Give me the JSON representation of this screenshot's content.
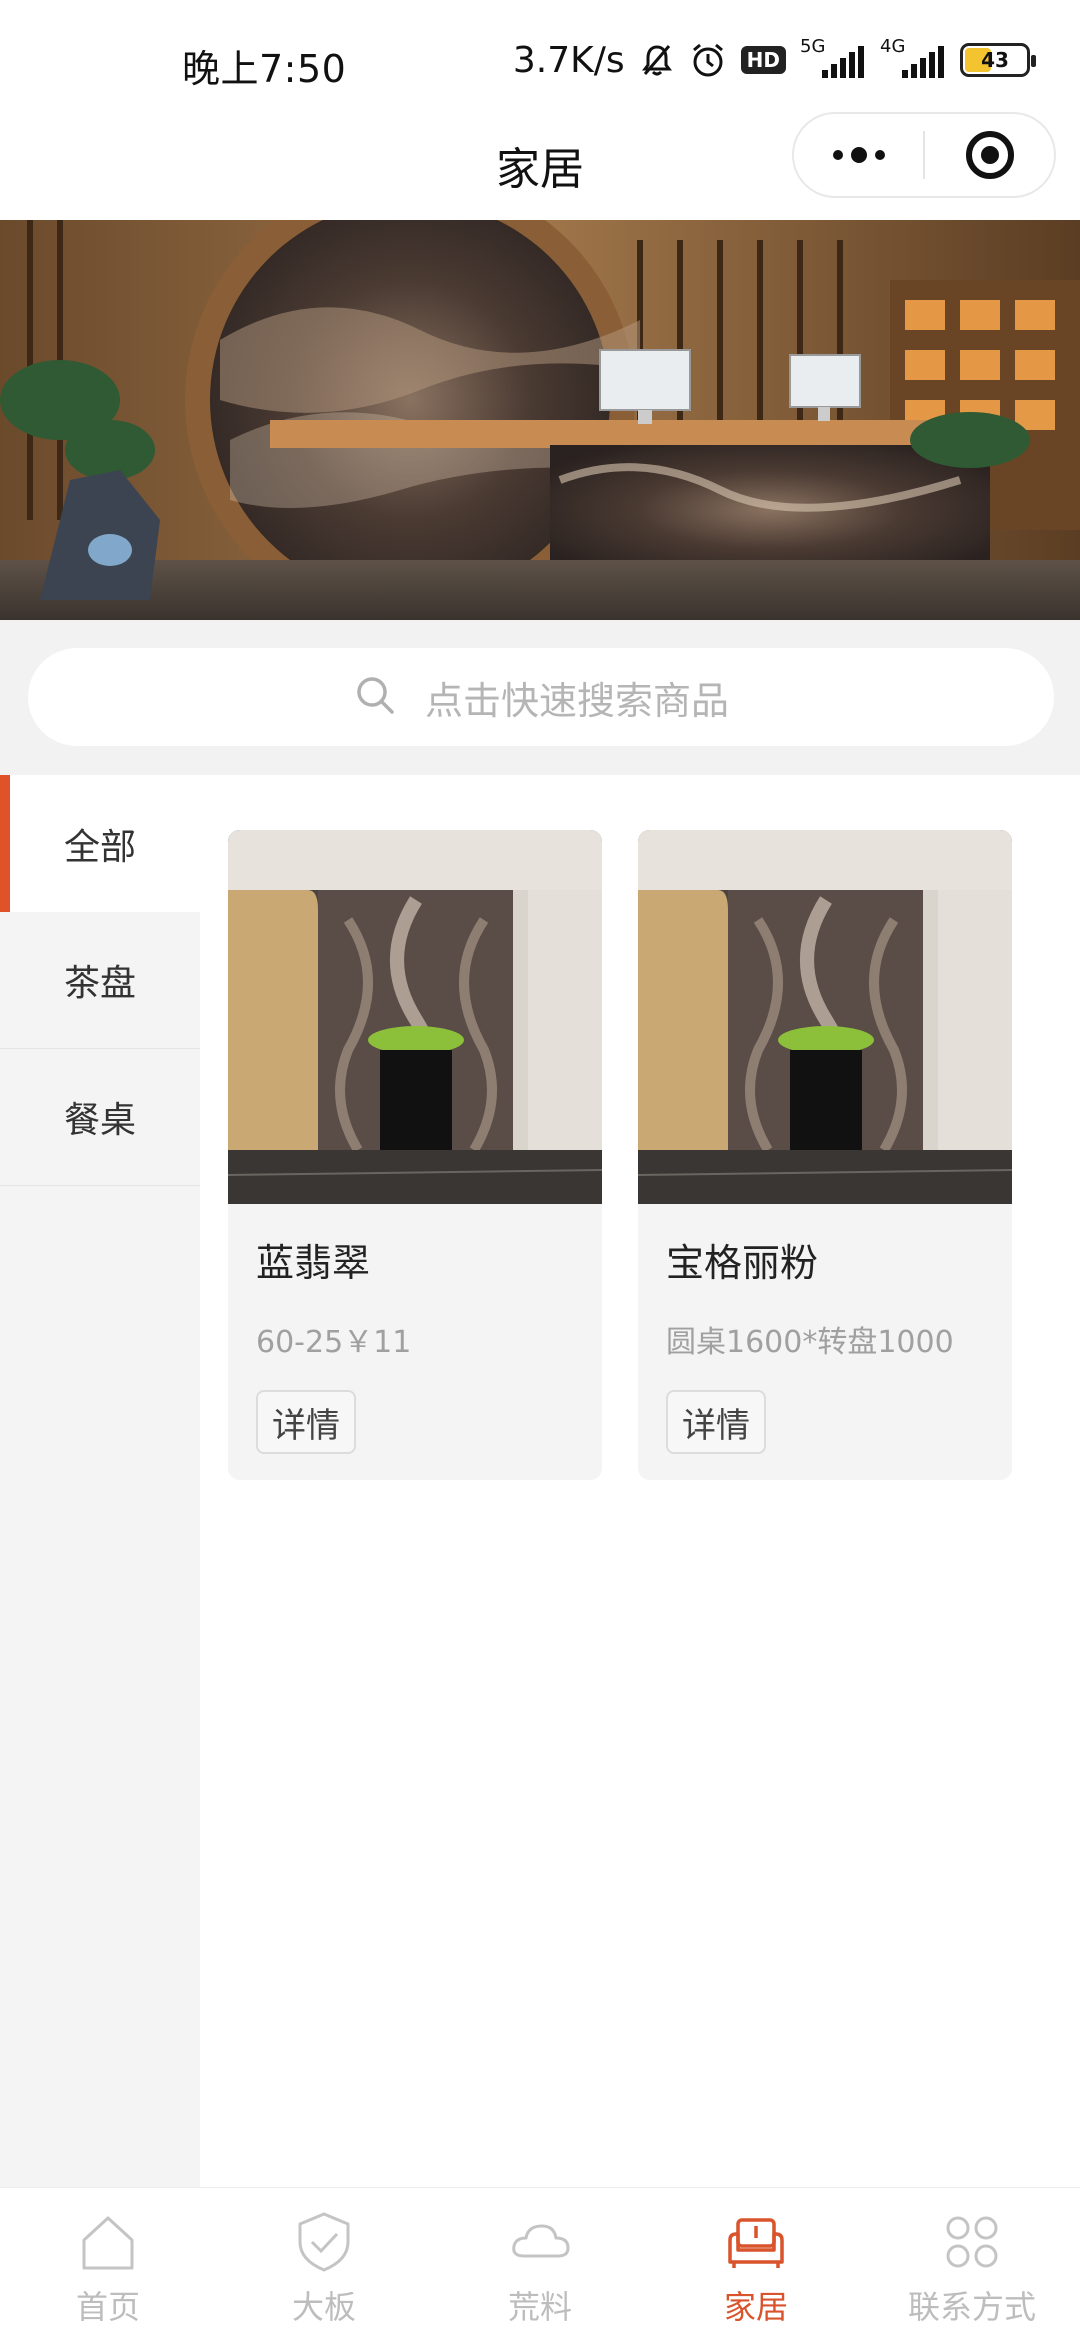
{
  "status_bar": {
    "time": "晚上7:50",
    "net_speed": "3.7K/s",
    "hd": "HD",
    "sim1": "5G",
    "sim2": "4G",
    "battery": "43"
  },
  "nav": {
    "title": "家居"
  },
  "search": {
    "placeholder": "点击快速搜索商品"
  },
  "sidebar": {
    "items": [
      {
        "label": "全部",
        "active": true
      },
      {
        "label": "茶盘",
        "active": false
      },
      {
        "label": "餐桌",
        "active": false
      }
    ]
  },
  "products": [
    {
      "name": "蓝翡翠",
      "spec": "60-25￥11",
      "button": "详情"
    },
    {
      "name": "宝格丽粉",
      "spec": "圆桌1600*转盘1000",
      "button": "详情"
    }
  ],
  "tabbar": {
    "items": [
      {
        "label": "首页",
        "icon": "home-icon",
        "active": false
      },
      {
        "label": "大板",
        "icon": "shield-check-icon",
        "active": false
      },
      {
        "label": "荒料",
        "icon": "cloud-icon",
        "active": false
      },
      {
        "label": "家居",
        "icon": "sofa-icon",
        "active": true
      },
      {
        "label": "联系方式",
        "icon": "grid-petals-icon",
        "active": false
      }
    ]
  },
  "colors": {
    "accent": "#e0532a",
    "tab_active": "#d9532c",
    "tab_inactive": "#bdbdbd",
    "sidebar_bg": "#f4f4f4",
    "search_bg": "#f2f2f2"
  }
}
